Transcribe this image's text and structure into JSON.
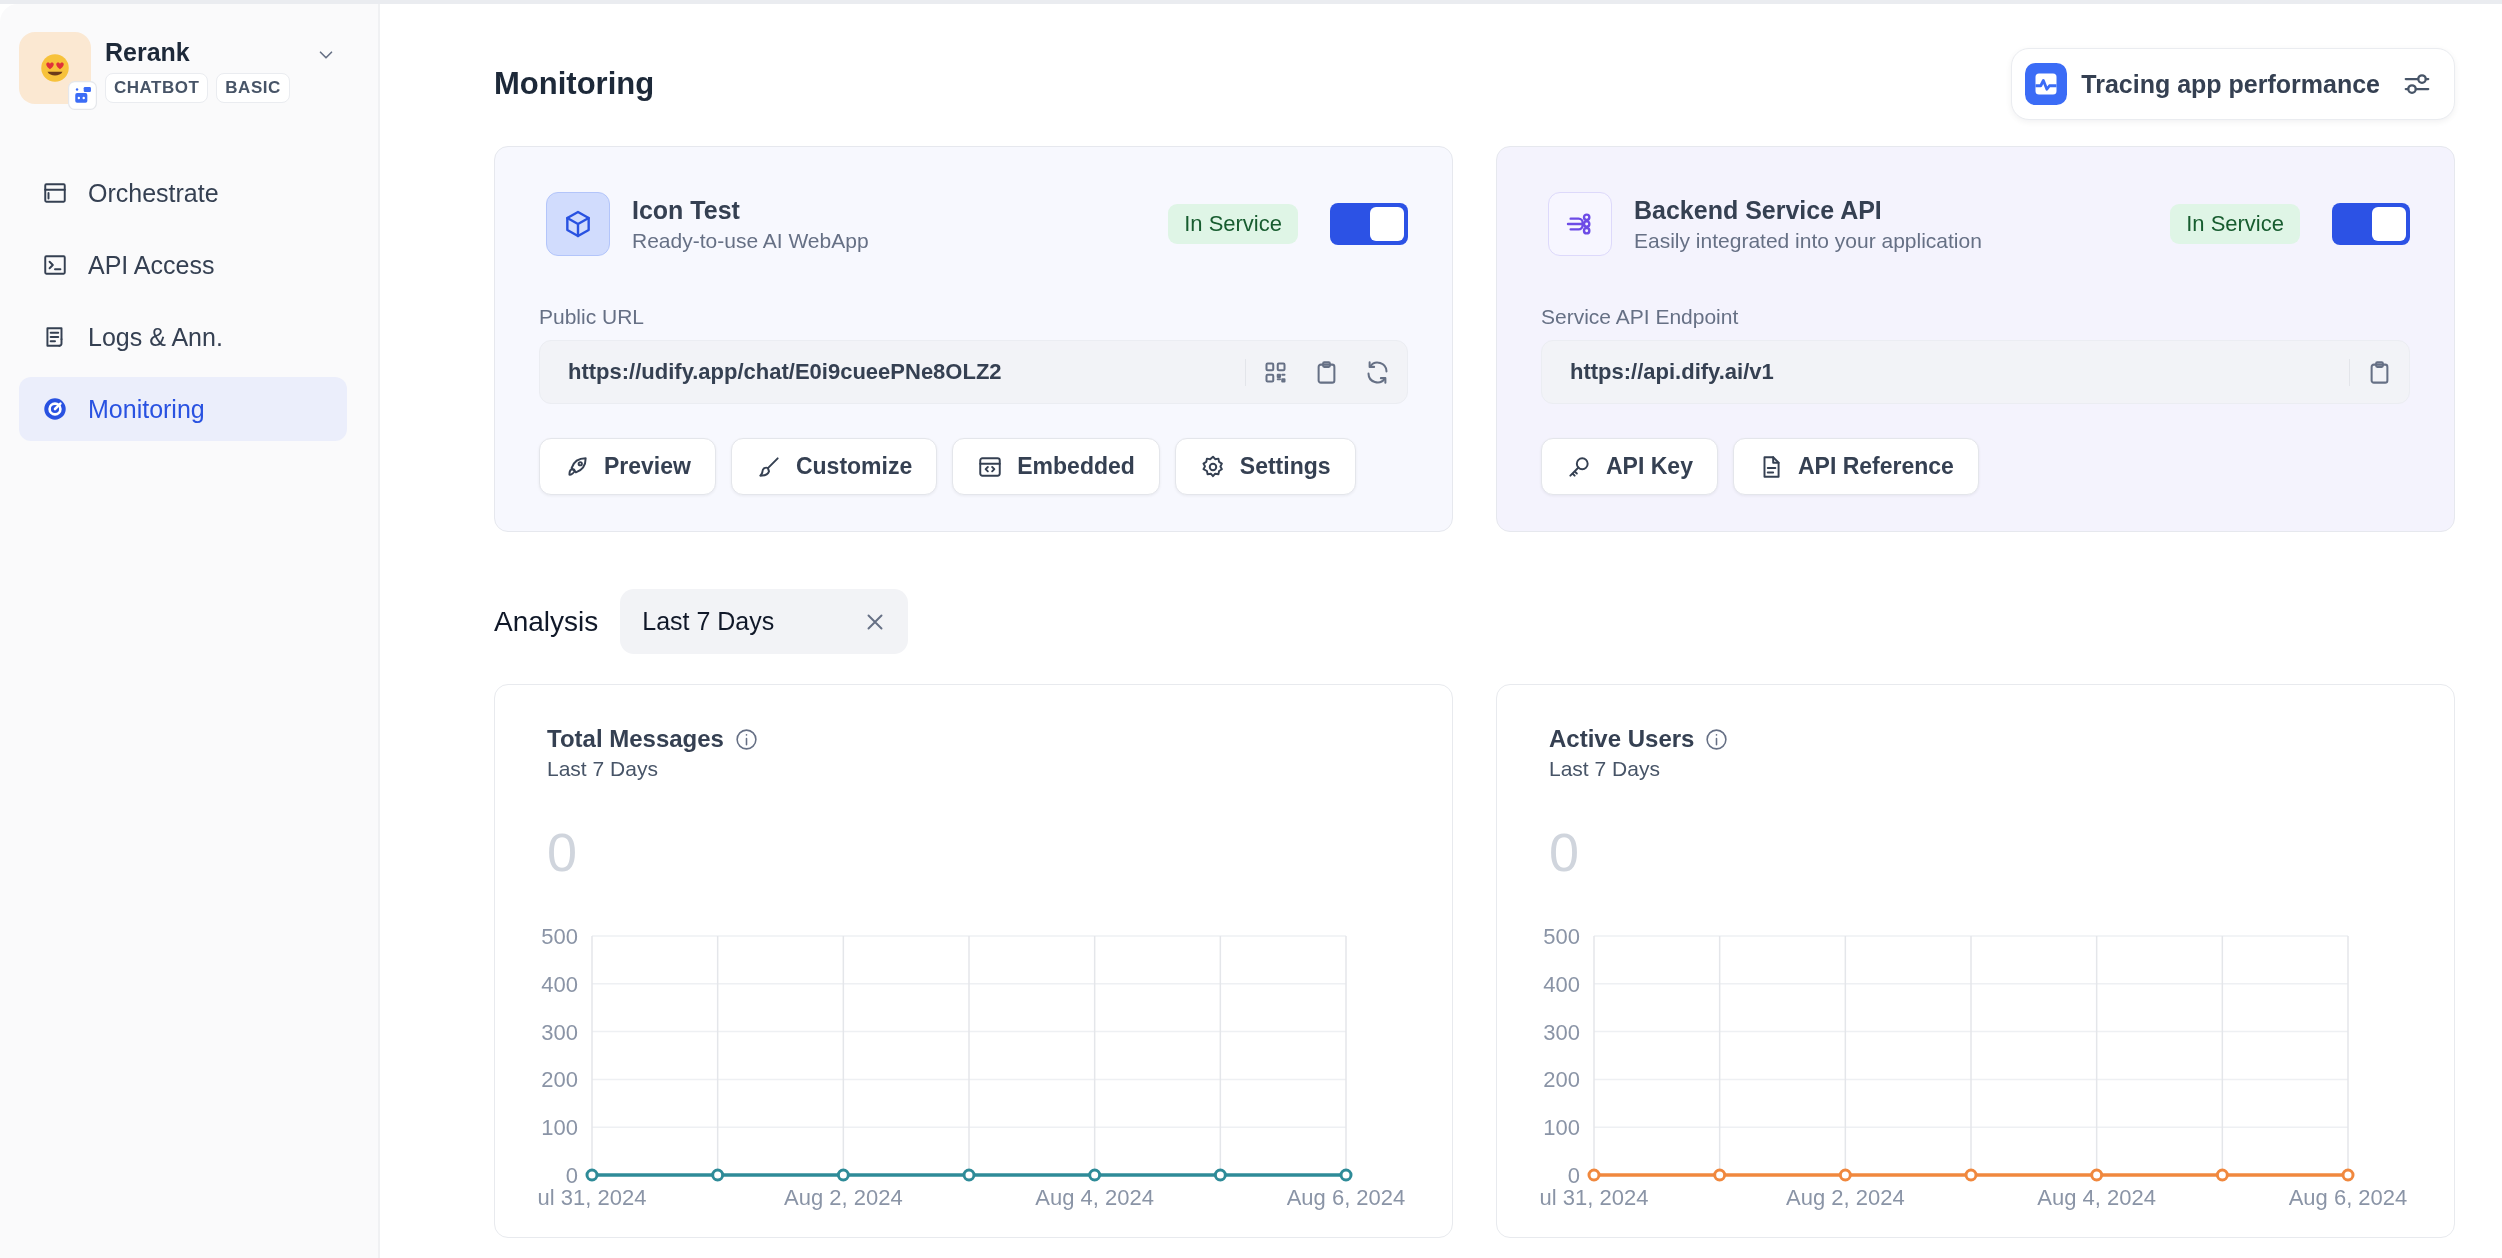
{
  "app": {
    "name": "Rerank",
    "badges": [
      "CHATBOT",
      "BASIC"
    ]
  },
  "sidebar": {
    "items": [
      {
        "label": "Orchestrate",
        "selected": false
      },
      {
        "label": "API Access",
        "selected": false
      },
      {
        "label": "Logs & Ann.",
        "selected": false
      },
      {
        "label": "Monitoring",
        "selected": true
      }
    ]
  },
  "header": {
    "title": "Monitoring",
    "tracing_button": "Tracing app performance"
  },
  "service_cards": [
    {
      "kind": "webapp",
      "title": "Icon Test",
      "subtitle": "Ready-to-use AI WebApp",
      "status": "In Service",
      "on": true,
      "field_label": "Public URL",
      "url": "https://udify.app/chat/E0i9cueePNe8OLZ2",
      "buttons": [
        "Preview",
        "Customize",
        "Embedded",
        "Settings"
      ]
    },
    {
      "kind": "api",
      "title": "Backend Service API",
      "subtitle": "Easily integrated into your application",
      "status": "In Service",
      "on": true,
      "field_label": "Service API Endpoint",
      "url": "https://api.dify.ai/v1",
      "buttons": [
        "API Key",
        "API Reference"
      ]
    }
  ],
  "analysis": {
    "label": "Analysis",
    "period": "Last 7 Days"
  },
  "charts": [
    {
      "title": "Total Messages",
      "subtitle": "Last 7 Days",
      "total": "0",
      "chart_data": {
        "type": "line",
        "categories": [
          "ul 31, 2024",
          null,
          "Aug 2, 2024",
          null,
          "Aug 4, 2024",
          null,
          "Aug 6, 2024"
        ],
        "ylim": [
          0,
          500
        ],
        "yticks": [
          0,
          100,
          200,
          300,
          400,
          500
        ],
        "grid": true,
        "series": [
          {
            "color": "#2e8b98",
            "marker": true,
            "values": [
              0,
              0,
              0,
              0,
              0,
              0,
              0
            ]
          }
        ]
      }
    },
    {
      "title": "Active Users",
      "subtitle": "Last 7 Days",
      "total": "0",
      "chart_data": {
        "type": "line",
        "categories": [
          "ul 31, 2024",
          null,
          "Aug 2, 2024",
          null,
          "Aug 4, 2024",
          null,
          "Aug 6, 2024"
        ],
        "ylim": [
          0,
          500
        ],
        "yticks": [
          0,
          100,
          200,
          300,
          400,
          500
        ],
        "grid": true,
        "series": [
          {
            "color": "#f0883e",
            "marker": true,
            "values": [
              0,
              0,
              0,
              0,
              0,
              0,
              0
            ]
          }
        ]
      }
    }
  ]
}
